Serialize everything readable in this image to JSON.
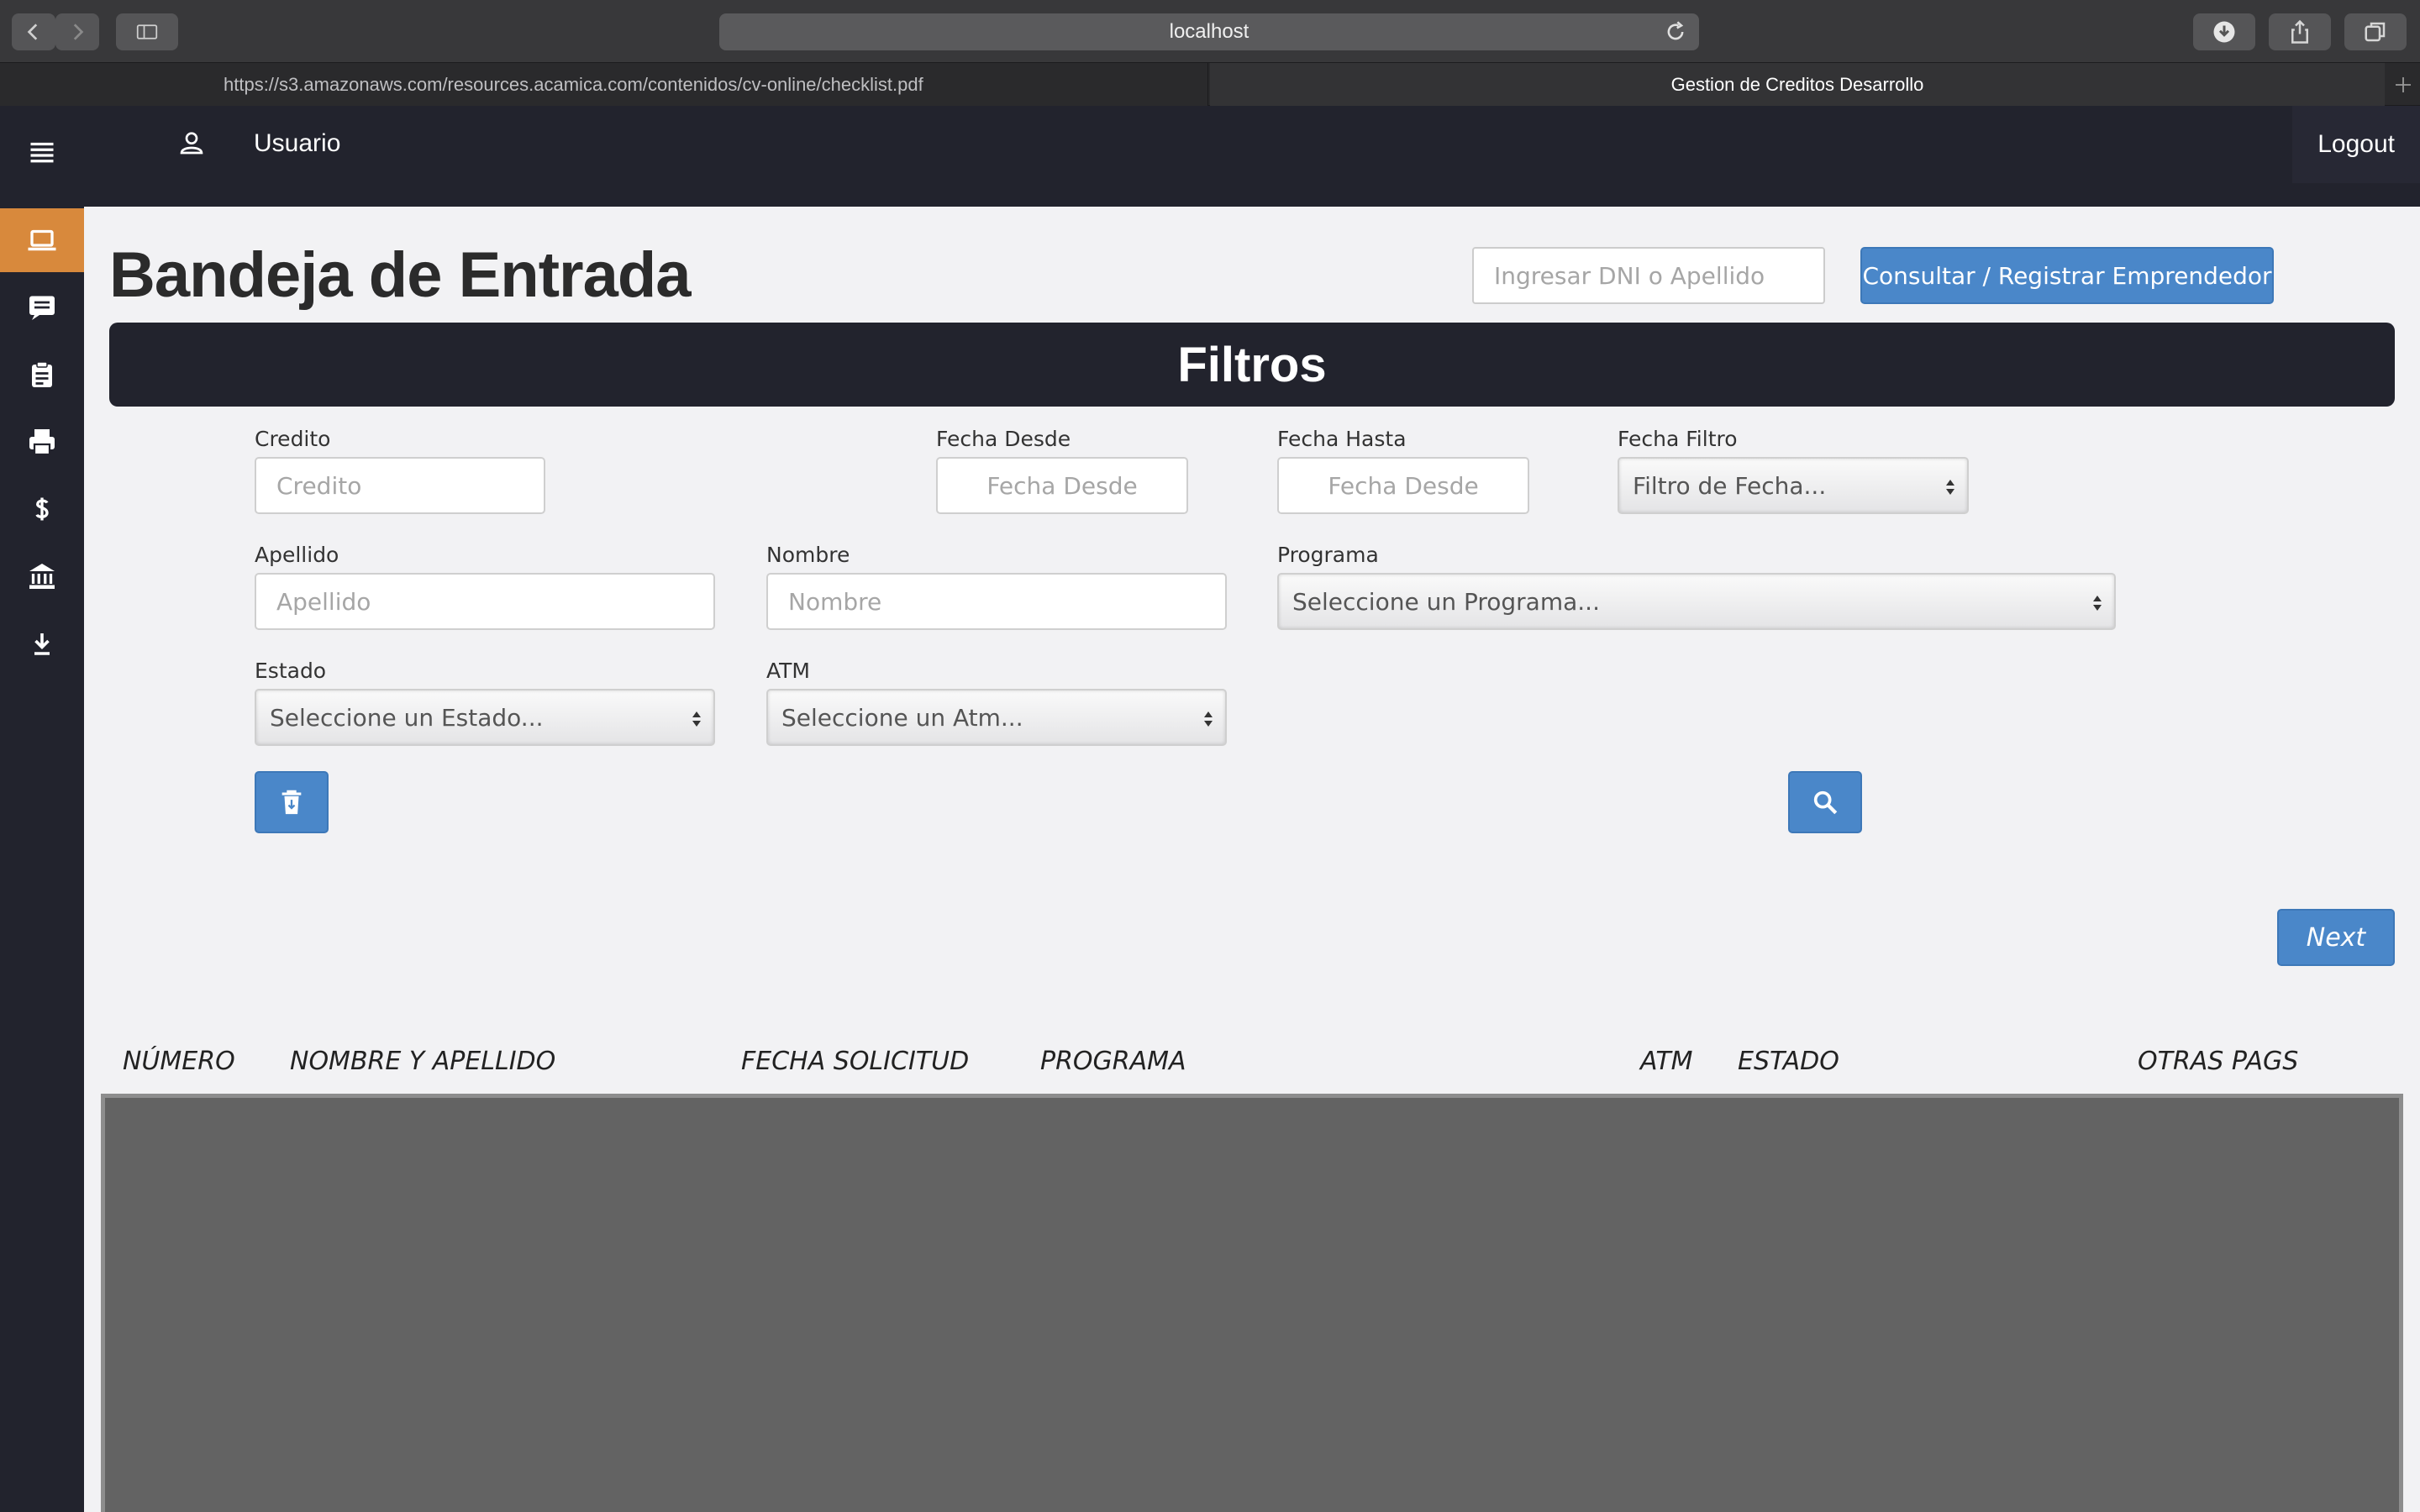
{
  "browser": {
    "url_display": "localhost",
    "tabs": [
      {
        "title": "https://s3.amazonaws.com/resources.acamica.com/contenidos/cv-online/checklist.pdf"
      },
      {
        "title": "Gestion de Creditos Desarrollo"
      }
    ]
  },
  "header": {
    "user_label": "Usuario",
    "logout_label": "Logout"
  },
  "sidebar": {
    "items": [
      {
        "icon": "menu-icon"
      },
      {
        "icon": "laptop-icon",
        "active": true
      },
      {
        "icon": "message-icon"
      },
      {
        "icon": "clipboard-icon"
      },
      {
        "icon": "printer-icon"
      },
      {
        "icon": "dollar-icon"
      },
      {
        "icon": "bank-icon"
      },
      {
        "icon": "download-icon"
      }
    ]
  },
  "page": {
    "title": "Bandeja de Entrada",
    "search_placeholder": "Ingresar DNI o Apellido",
    "consult_button": "Consultar / Registrar Emprendedor"
  },
  "filters": {
    "title": "Filtros",
    "credito": {
      "label": "Credito",
      "placeholder": "Credito"
    },
    "fecha_desde": {
      "label": "Fecha Desde",
      "placeholder": "Fecha Desde"
    },
    "fecha_hasta": {
      "label": "Fecha Hasta",
      "placeholder": "Fecha Desde"
    },
    "fecha_filtro": {
      "label": "Fecha Filtro",
      "value": "Filtro de Fecha..."
    },
    "apellido": {
      "label": "Apellido",
      "placeholder": "Apellido"
    },
    "nombre": {
      "label": "Nombre",
      "placeholder": "Nombre"
    },
    "programa": {
      "label": "Programa",
      "value": "Seleccione un Programa..."
    },
    "estado": {
      "label": "Estado",
      "value": "Seleccione un Estado..."
    },
    "atm": {
      "label": "ATM",
      "value": "Seleccione un Atm..."
    }
  },
  "pagination": {
    "next_label": "Next"
  },
  "table": {
    "columns": [
      "NÚMERO",
      "NOMBRE Y APELLIDO",
      "FECHA SOLICITUD",
      "PROGRAMA",
      "ATM",
      "ESTADO",
      "OTRAS PAGS"
    ],
    "rows": []
  },
  "colors": {
    "dark": "#22232d",
    "accent": "#d8893c",
    "primary": "#4a87c9"
  }
}
